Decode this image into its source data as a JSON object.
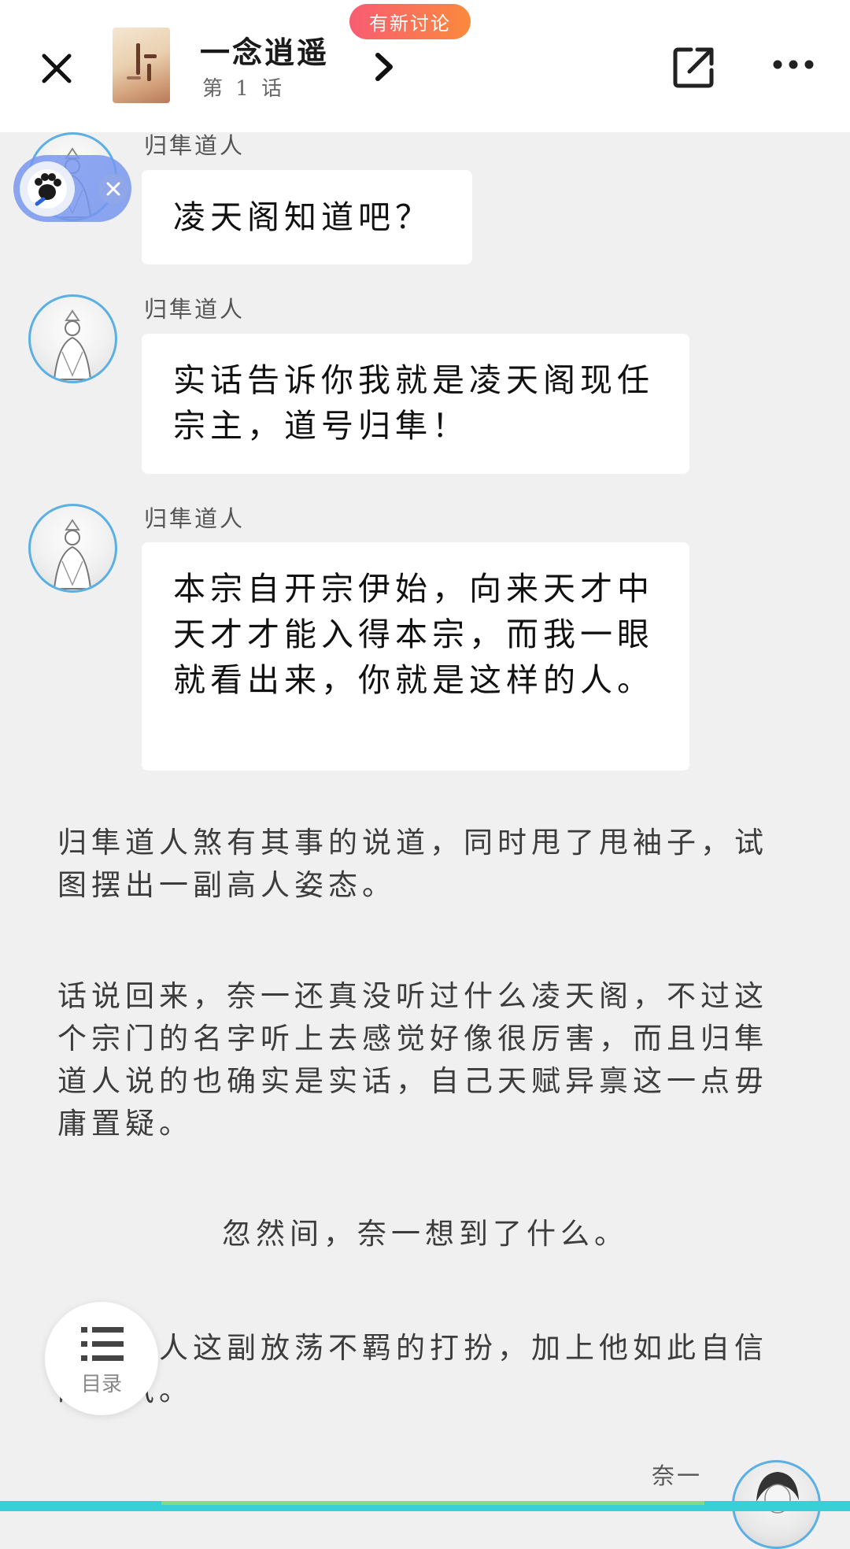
{
  "header": {
    "book_title": "一念逍遥",
    "chapter": "第 1 话",
    "badge": "有新讨论"
  },
  "chat": [
    {
      "speaker": "归隼道人",
      "text": "凌天阁知道吧？"
    },
    {
      "speaker": "归隼道人",
      "text": "实话告诉你我就是凌天阁现任宗主，道号归隼！"
    },
    {
      "speaker": "归隼道人",
      "text": "本宗自开宗伊始，向来天才中天才才能入得本宗，而我一眼就看出来，你就是这样的人。"
    }
  ],
  "paragraphs": [
    "归隼道人煞有其事的说道，同时甩了甩袖子，试图摆出一副高人姿态。",
    "话说回来，奈一还真没听过什么凌天阁，不过这个宗门的名字听上去感觉好像很厉害，而且归隼道人说的也确实是实话，自己天赋异禀这一点毋庸置疑。",
    "忽然间，奈一想到了什么。",
    "归隼道人这副放荡不羁的打扮，加上他如此自信的语气。"
  ],
  "next_speaker": "奈一",
  "toc": {
    "label": "目录"
  },
  "icons": {
    "close": "close-icon",
    "share": "share-icon",
    "more": "more-icon",
    "chevron": "chevron-right-icon",
    "toc": "list-icon",
    "assistant": "paw-icon"
  },
  "colors": {
    "accent_blue": "#5aafe3",
    "badge_start": "#f85c73",
    "badge_end": "#fb8a3c",
    "bottom_bar": "#38cfd6"
  }
}
